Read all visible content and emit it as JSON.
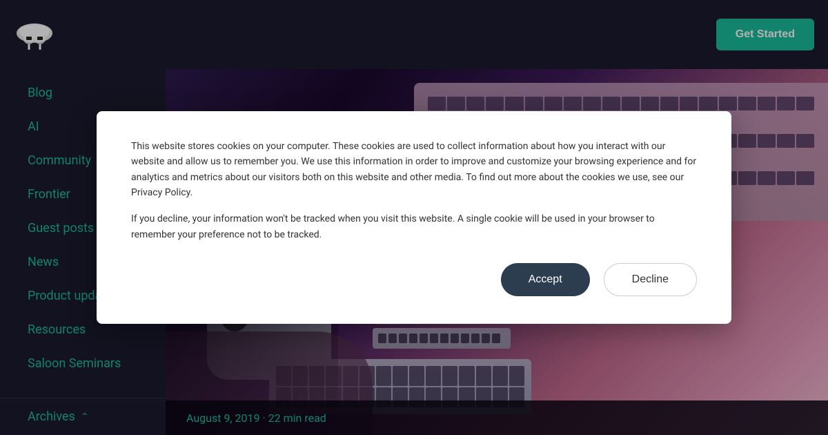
{
  "header": {
    "get_started_label": "Get Started"
  },
  "sidebar": {
    "items": [
      {
        "id": "blog",
        "label": "Blog"
      },
      {
        "id": "ai",
        "label": "AI"
      },
      {
        "id": "community",
        "label": "Community"
      },
      {
        "id": "frontier",
        "label": "Frontier"
      },
      {
        "id": "guest-posts",
        "label": "Guest posts"
      },
      {
        "id": "news",
        "label": "News"
      },
      {
        "id": "product-updates",
        "label": "Product updates"
      },
      {
        "id": "resources",
        "label": "Resources"
      },
      {
        "id": "saloon-seminars",
        "label": "Saloon Seminars"
      }
    ],
    "archives_label": "Archives",
    "archives_chevron": "^"
  },
  "hero": {
    "date": "August 9, 2019",
    "read_time": "22 min read",
    "date_separator": "·"
  },
  "cookie": {
    "main_text": "This website stores cookies on your computer. These cookies are used to collect information about how you interact with our website and allow us to remember you. We use this information in order to improve and customize your browsing experience and for analytics and metrics about our visitors both on this website and other media. To find out more about the cookies we use, see our Privacy Policy.",
    "secondary_text": "If you decline, your information won't be tracked when you visit this website. A single cookie will be used in your browser to remember your preference not to be tracked.",
    "accept_label": "Accept",
    "decline_label": "Decline"
  }
}
